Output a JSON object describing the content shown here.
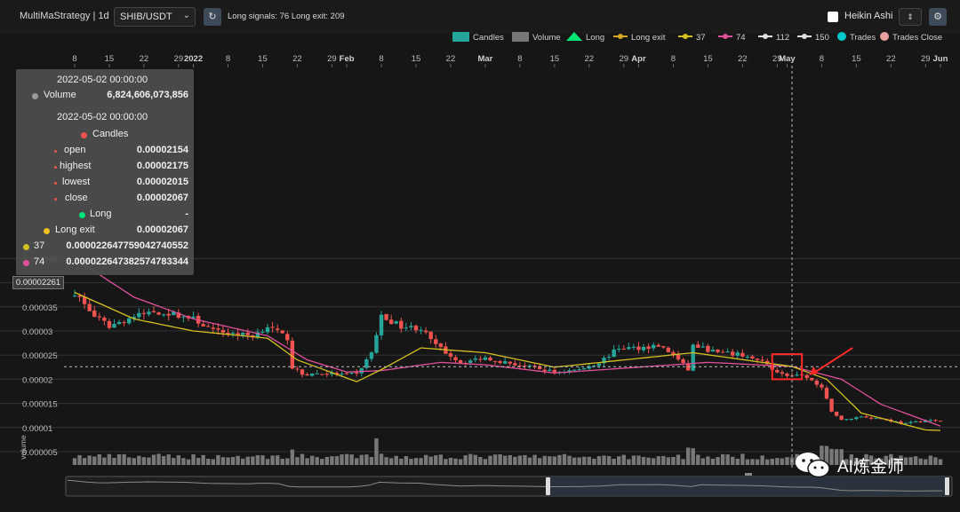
{
  "header": {
    "strategy_title": "MultiMaStrategy | 1d",
    "pair": "SHIB/USDT",
    "signals": "Long signals: 76   Long exit: 209",
    "heikin_ashi_label": "Heikin Ashi",
    "refresh_icon": "refresh-icon",
    "settings_icon": "gear-icon",
    "heikin_ashi_checked": false
  },
  "legend": [
    {
      "label": "Candles",
      "color": "#26a69a",
      "shape": "rect"
    },
    {
      "label": "Volume",
      "color": "#777777",
      "shape": "rect"
    },
    {
      "label": "Long",
      "color": "#00e676",
      "shape": "triangle"
    },
    {
      "label": "Long exit",
      "color": "#d4a820",
      "shape": "line-dot"
    },
    {
      "label": "37",
      "color": "#d4c020",
      "shape": "line-dot"
    },
    {
      "label": "74",
      "color": "#e0509a",
      "shape": "line-dot"
    },
    {
      "label": "112",
      "color": "#e0e0e0",
      "shape": "line-dot"
    },
    {
      "label": "150",
      "color": "#e0e0e0",
      "shape": "line-dot"
    },
    {
      "label": "Trades",
      "color": "#00c8c8",
      "shape": "circle"
    },
    {
      "label": "Trades Close",
      "color": "#e8a0a0",
      "shape": "circle"
    }
  ],
  "tooltip": {
    "date_volume": "2022-05-02 00:00:00",
    "volume_label": "Volume",
    "volume_value": "6,824,606,073,856",
    "date_candles": "2022-05-02 00:00:00",
    "candles_label": "Candles",
    "open_label": "open",
    "open_value": "0.00002154",
    "highest_label": "highest",
    "highest_value": "0.00002175",
    "lowest_label": "lowest",
    "lowest_value": "0.00002015",
    "close_label": "close",
    "close_value": "0.00002067",
    "long_label": "Long",
    "long_value": "-",
    "long_exit_label": "Long exit",
    "long_exit_value": "0.00002067",
    "ma37_label": "37",
    "ma37_value": "0.000022647759042740552",
    "ma74_label": "74",
    "ma74_value": "0.000022647382574783344"
  },
  "price_flag": "0.00002261",
  "watermark": "AI炼金师",
  "chart_data": {
    "type": "candlestick",
    "title": "",
    "ylabel": "",
    "volume_axis_label": "volume",
    "ylim": [
      4.3e-06,
      4.5e-05
    ],
    "y_ticks": [
      {
        "value": 4.5e-05,
        "label": "0.000045"
      },
      {
        "value": 4e-05,
        "label": "0.00004"
      },
      {
        "value": 3.5e-05,
        "label": "0.000035"
      },
      {
        "value": 3e-05,
        "label": "0.00003"
      },
      {
        "value": 2.5e-05,
        "label": "0.000025"
      },
      {
        "value": 2e-05,
        "label": "0.00002"
      },
      {
        "value": 1.5e-05,
        "label": "0.000015"
      },
      {
        "value": 1e-05,
        "label": "0.00001"
      },
      {
        "value": 5e-06,
        "label": "0.000005"
      }
    ],
    "x_start": "2021-12-01",
    "x_end": "2022-06-01",
    "x_ticks": [
      {
        "date": "2021-12-08",
        "label": "8",
        "bold": false
      },
      {
        "date": "2021-12-15",
        "label": "15",
        "bold": false
      },
      {
        "date": "2021-12-22",
        "label": "22",
        "bold": false
      },
      {
        "date": "2021-12-29",
        "label": "29",
        "bold": false
      },
      {
        "date": "2022-01-01",
        "label": "2022",
        "bold": true
      },
      {
        "date": "2022-01-08",
        "label": "8",
        "bold": false
      },
      {
        "date": "2022-01-15",
        "label": "15",
        "bold": false
      },
      {
        "date": "2022-01-22",
        "label": "22",
        "bold": false
      },
      {
        "date": "2022-01-29",
        "label": "29",
        "bold": false
      },
      {
        "date": "2022-02-01",
        "label": "Feb",
        "bold": true
      },
      {
        "date": "2022-02-08",
        "label": "8",
        "bold": false
      },
      {
        "date": "2022-02-15",
        "label": "15",
        "bold": false
      },
      {
        "date": "2022-02-22",
        "label": "22",
        "bold": false
      },
      {
        "date": "2022-03-01",
        "label": "Mar",
        "bold": true
      },
      {
        "date": "2022-03-08",
        "label": "8",
        "bold": false
      },
      {
        "date": "2022-03-15",
        "label": "15",
        "bold": false
      },
      {
        "date": "2022-03-22",
        "label": "22",
        "bold": false
      },
      {
        "date": "2022-03-29",
        "label": "29",
        "bold": false
      },
      {
        "date": "2022-04-01",
        "label": "Apr",
        "bold": true
      },
      {
        "date": "2022-04-08",
        "label": "8",
        "bold": false
      },
      {
        "date": "2022-04-15",
        "label": "15",
        "bold": false
      },
      {
        "date": "2022-04-22",
        "label": "22",
        "bold": false
      },
      {
        "date": "2022-04-29",
        "label": "29",
        "bold": false
      },
      {
        "date": "2022-05-01",
        "label": "May",
        "bold": true
      },
      {
        "date": "2022-05-08",
        "label": "8",
        "bold": false
      },
      {
        "date": "2022-05-15",
        "label": "15",
        "bold": false
      },
      {
        "date": "2022-05-22",
        "label": "22",
        "bold": false
      },
      {
        "date": "2022-05-29",
        "label": "29",
        "bold": false
      },
      {
        "date": "2022-06-01",
        "label": "Jun",
        "bold": true
      }
    ],
    "crosshair_date": "2022-05-02",
    "crosshair_value": 2.261e-05,
    "highlight_range": [
      "2022-04-28",
      "2022-05-04"
    ],
    "price_anchors": [
      {
        "date": "2021-12-08",
        "price": 3.8e-05
      },
      {
        "date": "2021-12-12",
        "price": 3.3e-05
      },
      {
        "date": "2021-12-15",
        "price": 3.1e-05
      },
      {
        "date": "2021-12-20",
        "price": 3.3e-05
      },
      {
        "date": "2021-12-24",
        "price": 3.4e-05
      },
      {
        "date": "2021-12-28",
        "price": 3.35e-05
      },
      {
        "date": "2022-01-01",
        "price": 3.25e-05
      },
      {
        "date": "2022-01-05",
        "price": 3e-05
      },
      {
        "date": "2022-01-09",
        "price": 2.95e-05
      },
      {
        "date": "2022-01-13",
        "price": 2.9e-05
      },
      {
        "date": "2022-01-16",
        "price": 3.1e-05
      },
      {
        "date": "2022-01-20",
        "price": 2.85e-05
      },
      {
        "date": "2022-01-21",
        "price": 2.25e-05
      },
      {
        "date": "2022-01-23",
        "price": 2.1e-05
      },
      {
        "date": "2022-01-27",
        "price": 2.12e-05
      },
      {
        "date": "2022-01-31",
        "price": 2.1e-05
      },
      {
        "date": "2022-02-03",
        "price": 2.1e-05
      },
      {
        "date": "2022-02-06",
        "price": 2.55e-05
      },
      {
        "date": "2022-02-08",
        "price": 3.3e-05
      },
      {
        "date": "2022-02-12",
        "price": 3.1e-05
      },
      {
        "date": "2022-02-16",
        "price": 3.05e-05
      },
      {
        "date": "2022-02-19",
        "price": 2.7e-05
      },
      {
        "date": "2022-02-24",
        "price": 2.35e-05
      },
      {
        "date": "2022-03-01",
        "price": 2.45e-05
      },
      {
        "date": "2022-03-05",
        "price": 2.35e-05
      },
      {
        "date": "2022-03-10",
        "price": 2.25e-05
      },
      {
        "date": "2022-03-15",
        "price": 2.15e-05
      },
      {
        "date": "2022-03-20",
        "price": 2.2e-05
      },
      {
        "date": "2022-03-24",
        "price": 2.35e-05
      },
      {
        "date": "2022-03-28",
        "price": 2.65e-05
      },
      {
        "date": "2022-04-01",
        "price": 2.65e-05
      },
      {
        "date": "2022-04-05",
        "price": 2.7e-05
      },
      {
        "date": "2022-04-08",
        "price": 2.5e-05
      },
      {
        "date": "2022-04-11",
        "price": 2.2e-05
      },
      {
        "date": "2022-04-12",
        "price": 2.7e-05
      },
      {
        "date": "2022-04-17",
        "price": 2.55e-05
      },
      {
        "date": "2022-04-22",
        "price": 2.5e-05
      },
      {
        "date": "2022-04-26",
        "price": 2.35e-05
      },
      {
        "date": "2022-04-30",
        "price": 2.1e-05
      },
      {
        "date": "2022-05-02",
        "price": 2.067e-05
      },
      {
        "date": "2022-05-05",
        "price": 2.05e-05
      },
      {
        "date": "2022-05-08",
        "price": 1.8e-05
      },
      {
        "date": "2022-05-10",
        "price": 1.35e-05
      },
      {
        "date": "2022-05-12",
        "price": 1.15e-05
      },
      {
        "date": "2022-05-16",
        "price": 1.23e-05
      },
      {
        "date": "2022-05-20",
        "price": 1.18e-05
      },
      {
        "date": "2022-05-25",
        "price": 1.08e-05
      },
      {
        "date": "2022-05-29",
        "price": 1.15e-05
      },
      {
        "date": "2022-06-01",
        "price": 1.13e-05
      }
    ],
    "ma37_anchors": [
      {
        "date": "2021-12-08",
        "price": 3.8e-05
      },
      {
        "date": "2021-12-20",
        "price": 3.25e-05
      },
      {
        "date": "2022-01-01",
        "price": 3e-05
      },
      {
        "date": "2022-01-16",
        "price": 2.85e-05
      },
      {
        "date": "2022-01-22",
        "price": 2.4e-05
      },
      {
        "date": "2022-02-03",
        "price": 1.95e-05
      },
      {
        "date": "2022-02-08",
        "price": 2.2e-05
      },
      {
        "date": "2022-02-16",
        "price": 2.65e-05
      },
      {
        "date": "2022-03-01",
        "price": 2.55e-05
      },
      {
        "date": "2022-03-15",
        "price": 2.25e-05
      },
      {
        "date": "2022-03-29",
        "price": 2.4e-05
      },
      {
        "date": "2022-04-12",
        "price": 2.55e-05
      },
      {
        "date": "2022-04-26",
        "price": 2.35e-05
      },
      {
        "date": "2022-05-02",
        "price": 2.265e-05
      },
      {
        "date": "2022-05-09",
        "price": 2e-05
      },
      {
        "date": "2022-05-16",
        "price": 1.3e-05
      },
      {
        "date": "2022-05-29",
        "price": 9.5e-06
      },
      {
        "date": "2022-06-01",
        "price": 9.4e-06
      }
    ],
    "ma74_anchors": [
      {
        "date": "2021-12-08",
        "price": 4.5e-05
      },
      {
        "date": "2021-12-20",
        "price": 3.7e-05
      },
      {
        "date": "2022-01-01",
        "price": 3.25e-05
      },
      {
        "date": "2022-01-16",
        "price": 2.9e-05
      },
      {
        "date": "2022-01-24",
        "price": 2.4e-05
      },
      {
        "date": "2022-02-01",
        "price": 2.15e-05
      },
      {
        "date": "2022-02-08",
        "price": 2.18e-05
      },
      {
        "date": "2022-02-20",
        "price": 2.35e-05
      },
      {
        "date": "2022-03-01",
        "price": 2.3e-05
      },
      {
        "date": "2022-03-15",
        "price": 2.13e-05
      },
      {
        "date": "2022-04-01",
        "price": 2.25e-05
      },
      {
        "date": "2022-04-15",
        "price": 2.35e-05
      },
      {
        "date": "2022-05-02",
        "price": 2.265e-05
      },
      {
        "date": "2022-05-12",
        "price": 2e-05
      },
      {
        "date": "2022-05-20",
        "price": 1.48e-05
      },
      {
        "date": "2022-06-01",
        "price": 1.03e-05
      }
    ],
    "volume_spikes": [
      {
        "date": "2022-01-21",
        "scale": 1.9
      },
      {
        "date": "2022-02-07",
        "scale": 2.5
      },
      {
        "date": "2022-02-08",
        "scale": 1.8
      },
      {
        "date": "2022-02-20",
        "scale": 1.6
      },
      {
        "date": "2022-04-11",
        "scale": 2.5
      },
      {
        "date": "2022-04-12",
        "scale": 1.7
      },
      {
        "date": "2022-05-08",
        "scale": 1.8
      },
      {
        "date": "2022-05-09",
        "scale": 2.0
      },
      {
        "date": "2022-05-10",
        "scale": 2.1
      },
      {
        "date": "2022-05-11",
        "scale": 2.0
      },
      {
        "date": "2022-05-12",
        "scale": 1.8
      }
    ]
  },
  "colors": {
    "up": "#26a69a",
    "down": "#ef5350",
    "ma37": "#d4c020",
    "ma74": "#e0509a",
    "grid": "#333333",
    "axis_text": "#bbbbbb",
    "volume": "#8a8a8a",
    "highlight": "#ff2a2a"
  }
}
